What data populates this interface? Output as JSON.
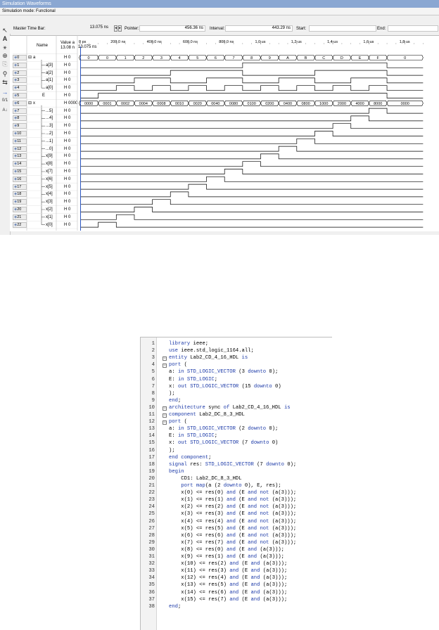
{
  "window": {
    "title": "Simulation Waveforms",
    "mode": "Simulation mode: Functional"
  },
  "toolbar": {
    "master_time_bar_label": "Master Time Bar:",
    "master_time_bar_value": "13.075 ns",
    "pointer_label": "Pointer:",
    "pointer_value": "456.36 ns",
    "interval_label": "Interval:",
    "interval_value": "443.29 ns",
    "start_label": "Start:",
    "start_value": "",
    "end_label": "End:",
    "end_value": ""
  },
  "columns": {
    "name": "Name",
    "value_line1": "Value a",
    "value_line2": "13.08 n"
  },
  "time_axis": {
    "cursor_label": "13.075 ns",
    "ticks": [
      "0 ps",
      "200,0 ns",
      "400,0 ns",
      "600,0 ns",
      "800,0 ns",
      "1,0 us",
      "1,2 us",
      "1,4 us",
      "1,6 us",
      "1,8 us"
    ]
  },
  "signals": [
    {
      "idx": "0",
      "name": "a",
      "value": "H 0",
      "expand": "⊟"
    },
    {
      "idx": "1",
      "name": "a[3]",
      "value": "H 0"
    },
    {
      "idx": "2",
      "name": "a[2]",
      "value": "H 0"
    },
    {
      "idx": "3",
      "name": "a[1]",
      "value": "H 0"
    },
    {
      "idx": "4",
      "name": "a[0]",
      "value": "H 0"
    },
    {
      "idx": "5",
      "name": "E",
      "value": "H 0"
    },
    {
      "idx": "6",
      "name": "x",
      "value": "H 0000",
      "expand": "⊟"
    },
    {
      "idx": "7",
      "name": "...5]",
      "value": "H 0"
    },
    {
      "idx": "8",
      "name": "...4]",
      "value": "H 0"
    },
    {
      "idx": "9",
      "name": "...3]",
      "value": "H 0"
    },
    {
      "idx": "10",
      "name": "...2]",
      "value": "H 0"
    },
    {
      "idx": "11",
      "name": "...1]",
      "value": "H 0"
    },
    {
      "idx": "12",
      "name": "...0]",
      "value": "H 0"
    },
    {
      "idx": "13",
      "name": "x[9]",
      "value": "H 0"
    },
    {
      "idx": "14",
      "name": "x[8]",
      "value": "H 0"
    },
    {
      "idx": "15",
      "name": "x[7]",
      "value": "H 0"
    },
    {
      "idx": "16",
      "name": "x[6]",
      "value": "H 0"
    },
    {
      "idx": "17",
      "name": "x[5]",
      "value": "H 0"
    },
    {
      "idx": "18",
      "name": "x[4]",
      "value": "H 0"
    },
    {
      "idx": "19",
      "name": "x[3]",
      "value": "H 0"
    },
    {
      "idx": "20",
      "name": "x[2]",
      "value": "H 0"
    },
    {
      "idx": "21",
      "name": "x[1]",
      "value": "H 0"
    },
    {
      "idx": "22",
      "name": "x[0]",
      "value": "H 0"
    }
  ],
  "bus_a_values": [
    "0",
    "0",
    "1",
    "2",
    "3",
    "4",
    "5",
    "6",
    "7",
    "8",
    "9",
    "A",
    "B",
    "C",
    "D",
    "E",
    "F",
    "0"
  ],
  "bus_x_values": [
    "0000",
    "0001",
    "0002",
    "0004",
    "0008",
    "0010",
    "0020",
    "0040",
    "0080",
    "0100",
    "0200",
    "0400",
    "0800",
    "1000",
    "2000",
    "4000",
    "8000",
    "0000"
  ],
  "code": {
    "line_numbers": [
      "1",
      "2",
      "3",
      "4",
      "5",
      "6",
      "7",
      "8",
      "9",
      "10",
      "11",
      "12",
      "13",
      "14",
      "15",
      "16",
      "17",
      "18",
      "19",
      "20",
      "21",
      "22",
      "23",
      "24",
      "25",
      "26",
      "27",
      "28",
      "29",
      "30",
      "31",
      "32",
      "33",
      "34",
      "35",
      "36",
      "37",
      "38"
    ],
    "lines": [
      "library ieee;",
      "use ieee.std_logic_1164.all;",
      "entity Lab2_CD_4_16_HDL is",
      "port (",
      "a: in STD_LOGIC_VECTOR (3 downto 0);",
      "E: in STD_LOGIC;",
      "x: out STD_LOGIC_VECTOR (15 downto 0)",
      ");",
      "end;",
      "architecture sync of Lab2_CD_4_16_HDL is",
      "component Lab2_DC_8_3_HDL",
      "port (",
      "a: in STD_LOGIC_VECTOR (2 downto 0);",
      "E: in STD_LOGIC;",
      "x: out STD_LOGIC_VECTOR (7 downto 0)",
      ");",
      "end component;",
      "signal res: STD_LOGIC_VECTOR (7 downto 0);",
      "begin",
      "    CD1: Lab2_DC_8_3_HDL",
      "    port map(a (2 downto 0), E, res);",
      "    x(0) <= res(0) and (E and not (a(3)));",
      "    x(1) <= res(1) and (E and not (a(3)));",
      "    x(2) <= res(2) and (E and not (a(3)));",
      "    x(3) <= res(3) and (E and not (a(3)));",
      "    x(4) <= res(4) and (E and not (a(3)));",
      "    x(5) <= res(5) and (E and not (a(3)));",
      "    x(6) <= res(6) and (E and not (a(3)));",
      "    x(7) <= res(7) and (E and not (a(3)));",
      "    x(8) <= res(0) and (E and (a(3)));",
      "    x(9) <= res(1) and (E and (a(3)));",
      "    x(10) <= res(2) and (E and (a(3)));",
      "    x(11) <= res(3) and (E and (a(3)));",
      "    x(12) <= res(4) and (E and (a(3)));",
      "    x(13) <= res(5) and (E and (a(3)));",
      "    x(14) <= res(6) and (E and (a(3)));",
      "    x(15) <= res(7) and (E and (a(3)));",
      "end;"
    ],
    "fold_lines": [
      3,
      4,
      10,
      11,
      12
    ]
  },
  "icons": [
    "select-tool-icon",
    "text-tool-icon",
    "waveform-editor-icon",
    "zoom-icon",
    "copy-icon",
    "find-icon",
    "replace-icon",
    "arrow-icon",
    "radix-icon",
    "sort-icon"
  ]
}
